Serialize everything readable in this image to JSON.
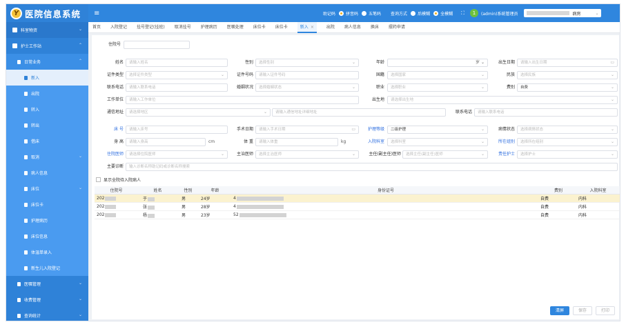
{
  "app": {
    "logo_char": "Y",
    "title": "医院信息系统"
  },
  "sidebar": {
    "top": {
      "label": "科室物资",
      "arrow": "⌄"
    },
    "nurse": {
      "label": "护士工作站",
      "arrow": "⌃"
    },
    "daily": {
      "label": "日常业务",
      "arrow": "⌃"
    },
    "items": [
      {
        "label": "新入"
      },
      {
        "label": "出院"
      },
      {
        "label": "转入"
      },
      {
        "label": "转出"
      },
      {
        "label": "借床"
      },
      {
        "label": "取消",
        "arrow": "⌄"
      },
      {
        "label": "病人信息"
      },
      {
        "label": "床位",
        "arrow": "⌄"
      },
      {
        "label": "床位卡"
      },
      {
        "label": "护理病历"
      },
      {
        "label": "床位信息"
      },
      {
        "label": "体温单录入"
      },
      {
        "label": "新生儿入院登记"
      }
    ],
    "bottom": [
      {
        "label": "医嘱管理",
        "arrow": "⌄"
      },
      {
        "label": "收费管理",
        "arrow": "⌄"
      },
      {
        "label": "查询统计",
        "arrow": "⌄"
      }
    ]
  },
  "topbar": {
    "menu_icon": "≡",
    "helpcode_label": "助记码",
    "helpcode_opt1": "拼音码",
    "helpcode_opt2": "五笔码",
    "query_label": "查询方式",
    "query_opt1": "后模糊",
    "query_opt2": "全模糊",
    "fullscreen_icon": "⛶",
    "avatar_char": "1",
    "user": "(admin)系统管理员",
    "dept_suffix": "病房",
    "dept_arrow": "⌄"
  },
  "tabs": [
    {
      "label": "首页"
    },
    {
      "label": "入院登记"
    },
    {
      "label": "挂号登记(挂班)"
    },
    {
      "label": "取消挂号"
    },
    {
      "label": "护理病历"
    },
    {
      "label": "医嘱处理"
    },
    {
      "label": "床位卡"
    },
    {
      "label": "床位卡"
    },
    {
      "label": "新入",
      "close": "×"
    },
    {
      "label": "出院"
    },
    {
      "label": "病人信息"
    },
    {
      "label": "换床"
    },
    {
      "label": "摆药申请"
    }
  ],
  "form": {
    "inpatient_no": {
      "label": "住院号",
      "value": ""
    },
    "name": {
      "label": "姓名",
      "placeholder": "请输入姓名"
    },
    "gender": {
      "label": "性别",
      "placeholder": "选择性别"
    },
    "age": {
      "label": "年龄",
      "unit": "岁"
    },
    "birth": {
      "label": "出生日期",
      "placeholder": "请输入出生日期"
    },
    "id_type": {
      "label": "证件类型",
      "placeholder": "选择证件类型"
    },
    "id_no": {
      "label": "证件号码",
      "placeholder": "请输入证件号码"
    },
    "nationality": {
      "label": "国籍",
      "placeholder": "选择国家"
    },
    "ethnic": {
      "label": "民族",
      "placeholder": "选择民族"
    },
    "phone": {
      "label": "联系电话",
      "placeholder": "请输入联系电话"
    },
    "marital": {
      "label": "婚姻状况",
      "placeholder": "选择婚姻状态"
    },
    "job": {
      "label": "职业",
      "placeholder": "选择职业"
    },
    "fee_type": {
      "label": "费别",
      "value": "自费"
    },
    "work": {
      "label": "工作单位",
      "placeholder": "请输入工作单位"
    },
    "birthplace": {
      "label": "出生地",
      "placeholder": "请选择出生地"
    },
    "address": {
      "label": "通信地址",
      "placeholder": "请选择地区",
      "detail_placeholder": "请输入通信地址详细地址"
    },
    "contact_phone": {
      "label": "联系电话",
      "placeholder": "请输入联系电话"
    },
    "bed": {
      "label": "床 号",
      "placeholder": "请输入床号"
    },
    "surgery_date": {
      "label": "手术日期",
      "placeholder": "请输入手术日期"
    },
    "care_level": {
      "label": "护理等级",
      "value": "二级护理"
    },
    "condition": {
      "label": "病情状态",
      "placeholder": "选择病情状态"
    },
    "height": {
      "label": "身 高",
      "placeholder": "请输入身高",
      "unit": "cm"
    },
    "weight": {
      "label": "体 重",
      "placeholder": "请输入体重",
      "unit": "kg"
    },
    "admit_dept": {
      "label": "入院科室",
      "placeholder": "选择科室"
    },
    "group": {
      "label": "所在组别",
      "placeholder": "选择所在组别"
    },
    "resident": {
      "label": "住院医师",
      "placeholder": "请选择住院医师"
    },
    "attending": {
      "label": "主治医师",
      "placeholder": "选择主治医师"
    },
    "chief": {
      "label": "主任(副主任)医师",
      "placeholder": "选择主任(副主任)医师"
    },
    "nurse": {
      "label": "责任护士",
      "placeholder": "选择护士"
    },
    "diagnosis": {
      "label": "主要诊断",
      "placeholder": "输入诊断名称助记码或诊断名称搜索"
    }
  },
  "show_all": {
    "label": "显示全院待入院病人"
  },
  "grid": {
    "headers": [
      "住院号",
      "姓名",
      "性别",
      "年龄",
      "身份证号",
      "费别",
      "入院科室"
    ],
    "rows": [
      {
        "no": "202",
        "name": "于",
        "gender": "男",
        "age": "24岁",
        "id": "4",
        "fee": "自费",
        "dept": "内科"
      },
      {
        "no": "202",
        "name": "张",
        "gender": "男",
        "age": "28岁",
        "id": "4",
        "fee": "自费",
        "dept": "内科"
      },
      {
        "no": "202",
        "name": "杨",
        "gender": "男",
        "age": "23岁",
        "id": "52",
        "fee": "自费",
        "dept": "内科"
      }
    ]
  },
  "buttons": {
    "clear": "清屏",
    "save": "保存",
    "print": "打印"
  }
}
